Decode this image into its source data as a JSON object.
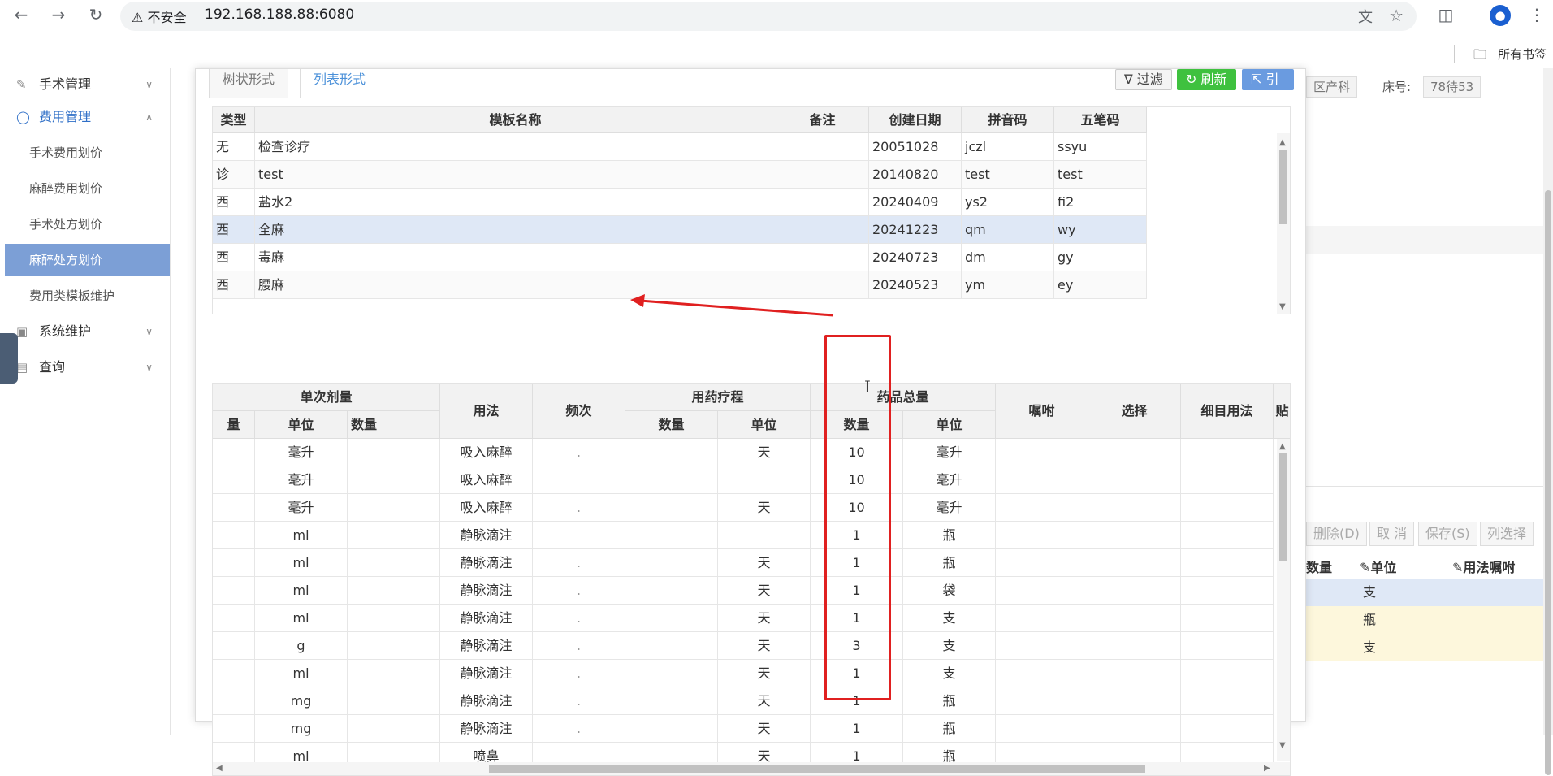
{
  "browser": {
    "address_warning": "不安全",
    "url": "192.168.188.88:6080",
    "bookmarks_label": "所有书签"
  },
  "sidebar": {
    "items": [
      {
        "label": "手术管理",
        "type": "parent"
      },
      {
        "label": "费用管理",
        "type": "parent-open"
      },
      {
        "label": "手术费用划价",
        "type": "sub"
      },
      {
        "label": "麻醉费用划价",
        "type": "sub"
      },
      {
        "label": "手术处方划价",
        "type": "sub"
      },
      {
        "label": "麻醉处方划价",
        "type": "sub-active"
      },
      {
        "label": "费用类模板维护",
        "type": "sub"
      },
      {
        "label": "系统维护",
        "type": "parent"
      },
      {
        "label": "查询",
        "type": "parent"
      }
    ]
  },
  "background": {
    "dept_chip": "区产科",
    "bed_label": "床号:",
    "bed_value": "78待53",
    "buttons": [
      "删除(D)",
      "取 消",
      "保存(S)",
      "列选择"
    ],
    "col_headers": [
      "数量",
      "单位",
      "用法嘱咐"
    ],
    "rows": [
      "支",
      "瓶",
      "支"
    ]
  },
  "modal": {
    "tabs": [
      "树状形式",
      "列表形式"
    ],
    "toolbar": {
      "filter": "过滤",
      "refresh": "刷新",
      "cite": "引用"
    },
    "template_grid": {
      "headers": [
        "类型",
        "模板名称",
        "备注",
        "创建日期",
        "拼音码",
        "五笔码"
      ],
      "rows": [
        [
          "无",
          "检查诊疗",
          "",
          "20051028",
          "jczl",
          "ssyu"
        ],
        [
          "诊",
          "test",
          "",
          "20140820",
          "test",
          "test"
        ],
        [
          "西",
          "盐水2",
          "",
          "20240409",
          "ys2",
          "fi2"
        ],
        [
          "西",
          "全麻",
          "",
          "20241223",
          "qm",
          "wy"
        ],
        [
          "西",
          "毒麻",
          "",
          "20240723",
          "dm",
          "gy"
        ],
        [
          "西",
          "腰麻",
          "",
          "20240523",
          "ym",
          "ey"
        ]
      ]
    },
    "detail_grid": {
      "group_headers": {
        "single_dose": "单次剂量",
        "usage": "用法",
        "freq": "频次",
        "course": "用药疗程",
        "total": "药品总量",
        "note": "嘱咐",
        "select": "选择",
        "detail_usage": "细目用法",
        "paste": "贴"
      },
      "sub_headers": {
        "cut": "量",
        "unit": "单位",
        "qty": "数量",
        "course_qty": "数量",
        "course_unit": "单位",
        "total_qty": "数量",
        "total_unit": "单位"
      },
      "rows": [
        {
          "unit": "毫升",
          "usage": "吸入麻醉",
          "freq": ".",
          "course_unit": "天",
          "total_qty": "10",
          "total_unit": "毫升"
        },
        {
          "unit": "毫升",
          "usage": "吸入麻醉",
          "freq": "",
          "course_unit": "",
          "total_qty": "10",
          "total_unit": "毫升"
        },
        {
          "unit": "毫升",
          "usage": "吸入麻醉",
          "freq": ".",
          "course_unit": "天",
          "total_qty": "10",
          "total_unit": "毫升"
        },
        {
          "unit": "ml",
          "usage": "静脉滴注",
          "freq": "",
          "course_unit": "",
          "total_qty": "1",
          "total_unit": "瓶"
        },
        {
          "unit": "ml",
          "usage": "静脉滴注",
          "freq": ".",
          "course_unit": "天",
          "total_qty": "1",
          "total_unit": "瓶"
        },
        {
          "unit": "ml",
          "usage": "静脉滴注",
          "freq": ".",
          "course_unit": "天",
          "total_qty": "1",
          "total_unit": "袋"
        },
        {
          "unit": "ml",
          "usage": "静脉滴注",
          "freq": ".",
          "course_unit": "天",
          "total_qty": "1",
          "total_unit": "支"
        },
        {
          "unit": "g",
          "usage": "静脉滴注",
          "freq": ".",
          "course_unit": "天",
          "total_qty": "3",
          "total_unit": "支"
        },
        {
          "unit": "ml",
          "usage": "静脉滴注",
          "freq": ".",
          "course_unit": "天",
          "total_qty": "1",
          "total_unit": "支"
        },
        {
          "unit": "mg",
          "usage": "静脉滴注",
          "freq": ".",
          "course_unit": "天",
          "total_qty": "1",
          "total_unit": "瓶"
        },
        {
          "unit": "mg",
          "usage": "静脉滴注",
          "freq": ".",
          "course_unit": "天",
          "total_qty": "1",
          "total_unit": "瓶"
        },
        {
          "unit": "ml",
          "usage": "喷鼻",
          "freq": "",
          "course_unit": "天",
          "total_qty": "1",
          "total_unit": "瓶"
        }
      ]
    }
  },
  "colors": {
    "annotation_red": "#e02020",
    "selected_row": "#dfe8f6",
    "accent_blue": "#4a90d9"
  }
}
